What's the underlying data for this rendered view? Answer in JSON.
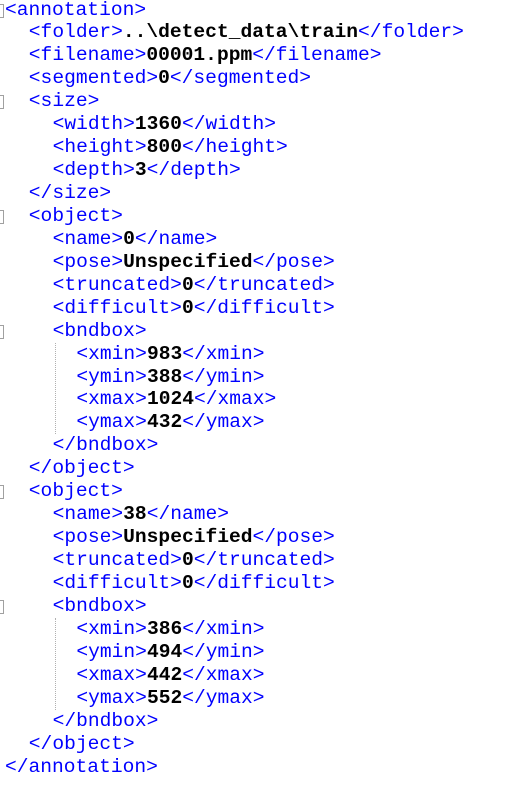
{
  "lines": [
    {
      "indent": 0,
      "open": "<annotation>",
      "fold": true
    },
    {
      "indent": 1,
      "open": "<folder>",
      "text": "..\\detect_data\\train",
      "close": "</folder>"
    },
    {
      "indent": 1,
      "open": "<filename>",
      "text": "00001.ppm",
      "close": "</filename>"
    },
    {
      "indent": 1,
      "open": "<segmented>",
      "text": "0",
      "close": "</segmented>"
    },
    {
      "indent": 1,
      "open": "<size>",
      "fold": true
    },
    {
      "indent": 2,
      "open": "<width>",
      "text": "1360",
      "close": "</width>"
    },
    {
      "indent": 2,
      "open": "<height>",
      "text": "800",
      "close": "</height>"
    },
    {
      "indent": 2,
      "open": "<depth>",
      "text": "3",
      "close": "</depth>"
    },
    {
      "indent": 1,
      "open": "</size>"
    },
    {
      "indent": 1,
      "open": "<object>",
      "fold": true
    },
    {
      "indent": 2,
      "open": "<name>",
      "text": "0",
      "close": "</name>"
    },
    {
      "indent": 2,
      "open": "<pose>",
      "text": "Unspecified",
      "close": "</pose>"
    },
    {
      "indent": 2,
      "open": "<truncated>",
      "text": "0",
      "close": "</truncated>"
    },
    {
      "indent": 2,
      "open": "<difficult>",
      "text": "0",
      "close": "</difficult>"
    },
    {
      "indent": 2,
      "open": "<bndbox>",
      "fold": true
    },
    {
      "indent": 3,
      "open": "<xmin>",
      "text": "983",
      "close": "</xmin>"
    },
    {
      "indent": 3,
      "open": "<ymin>",
      "text": "388",
      "close": "</ymin>"
    },
    {
      "indent": 3,
      "open": "<xmax>",
      "text": "1024",
      "close": "</xmax>"
    },
    {
      "indent": 3,
      "open": "<ymax>",
      "text": "432",
      "close": "</ymax>"
    },
    {
      "indent": 2,
      "open": "</bndbox>"
    },
    {
      "indent": 1,
      "open": "</object>"
    },
    {
      "indent": 1,
      "open": "<object>",
      "fold": true
    },
    {
      "indent": 2,
      "open": "<name>",
      "text": "38",
      "close": "</name>"
    },
    {
      "indent": 2,
      "open": "<pose>",
      "text": "Unspecified",
      "close": "</pose>"
    },
    {
      "indent": 2,
      "open": "<truncated>",
      "text": "0",
      "close": "</truncated>"
    },
    {
      "indent": 2,
      "open": "<difficult>",
      "text": "0",
      "close": "</difficult>"
    },
    {
      "indent": 2,
      "open": "<bndbox>",
      "fold": true
    },
    {
      "indent": 3,
      "open": "<xmin>",
      "text": "386",
      "close": "</xmin>"
    },
    {
      "indent": 3,
      "open": "<ymin>",
      "text": "494",
      "close": "</ymin>"
    },
    {
      "indent": 3,
      "open": "<xmax>",
      "text": "442",
      "close": "</xmax>"
    },
    {
      "indent": 3,
      "open": "<ymax>",
      "text": "552",
      "close": "</ymax>"
    },
    {
      "indent": 2,
      "open": "</bndbox>"
    },
    {
      "indent": 1,
      "open": "</object>"
    },
    {
      "indent": 0,
      "open": "</annotation>"
    }
  ],
  "colors": {
    "tag": "#0000ff",
    "value": "#000000"
  }
}
